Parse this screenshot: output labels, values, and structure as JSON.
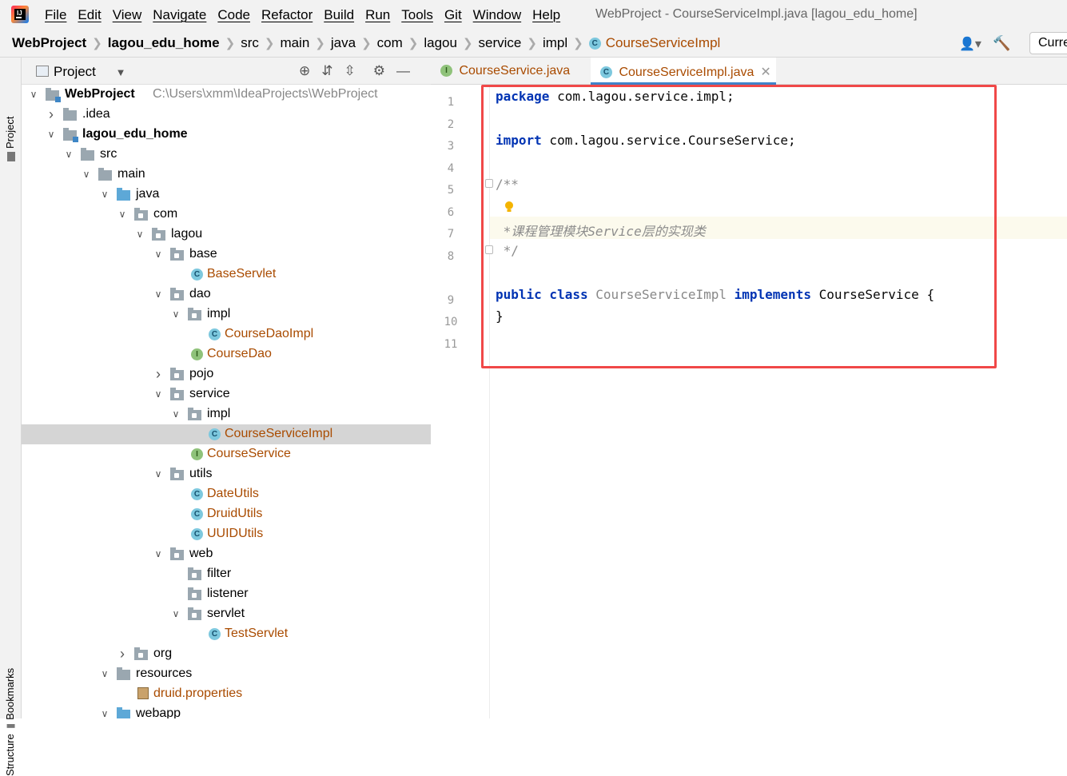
{
  "menubar": {
    "items": [
      "File",
      "Edit",
      "View",
      "Navigate",
      "Code",
      "Refactor",
      "Build",
      "Run",
      "Tools",
      "Git",
      "Window",
      "Help"
    ],
    "title": "WebProject - CourseServiceImpl.java [lagou_edu_home]"
  },
  "breadcrumb": [
    "WebProject",
    "lagou_edu_home",
    "src",
    "main",
    "java",
    "com",
    "lagou",
    "service",
    "impl",
    "CourseServiceImpl"
  ],
  "toolbar": {
    "run_config": "Current File"
  },
  "sidebar": {
    "project_tab": "Project",
    "bookmarks_tab": "Bookmarks",
    "structure_tab": "Structure"
  },
  "project": {
    "title": "Project"
  },
  "tree": [
    {
      "label": "WebProject",
      "extra": "C:\\Users\\xmm\\IdeaProjects\\WebProject",
      "depth": 0,
      "arrow": "open",
      "icon": "module-folder",
      "bold": true
    },
    {
      "label": ".idea",
      "depth": 1,
      "arrow": "closed",
      "icon": "folder"
    },
    {
      "label": "lagou_edu_home",
      "depth": 1,
      "arrow": "open",
      "icon": "module-folder",
      "bold": true
    },
    {
      "label": "src",
      "depth": 2,
      "arrow": "open",
      "icon": "folder"
    },
    {
      "label": "main",
      "depth": 3,
      "arrow": "open",
      "icon": "folder"
    },
    {
      "label": "java",
      "depth": 4,
      "arrow": "open",
      "icon": "source-folder"
    },
    {
      "label": "com",
      "depth": 5,
      "arrow": "open",
      "icon": "package"
    },
    {
      "label": "lagou",
      "depth": 6,
      "arrow": "open",
      "icon": "package"
    },
    {
      "label": "base",
      "depth": 7,
      "arrow": "open",
      "icon": "package"
    },
    {
      "label": "BaseServlet",
      "depth": 8,
      "arrow": "none",
      "icon": "class"
    },
    {
      "label": "dao",
      "depth": 7,
      "arrow": "open",
      "icon": "package"
    },
    {
      "label": "impl",
      "depth": 8,
      "arrow": "open",
      "icon": "package"
    },
    {
      "label": "CourseDaoImpl",
      "depth": 9,
      "arrow": "none",
      "icon": "class"
    },
    {
      "label": "CourseDao",
      "depth": 8,
      "arrow": "none",
      "icon": "interface"
    },
    {
      "label": "pojo",
      "depth": 7,
      "arrow": "closed",
      "icon": "package"
    },
    {
      "label": "service",
      "depth": 7,
      "arrow": "open",
      "icon": "package"
    },
    {
      "label": "impl",
      "depth": 8,
      "arrow": "open",
      "icon": "package"
    },
    {
      "label": "CourseServiceImpl",
      "depth": 9,
      "arrow": "none",
      "icon": "class",
      "selected": true
    },
    {
      "label": "CourseService",
      "depth": 8,
      "arrow": "none",
      "icon": "interface"
    },
    {
      "label": "utils",
      "depth": 7,
      "arrow": "open",
      "icon": "package"
    },
    {
      "label": "DateUtils",
      "depth": 8,
      "arrow": "none",
      "icon": "class"
    },
    {
      "label": "DruidUtils",
      "depth": 8,
      "arrow": "none",
      "icon": "class"
    },
    {
      "label": "UUIDUtils",
      "depth": 8,
      "arrow": "none",
      "icon": "class"
    },
    {
      "label": "web",
      "depth": 7,
      "arrow": "open",
      "icon": "package"
    },
    {
      "label": "filter",
      "depth": 8,
      "arrow": "none",
      "icon": "package"
    },
    {
      "label": "listener",
      "depth": 8,
      "arrow": "none",
      "icon": "package"
    },
    {
      "label": "servlet",
      "depth": 8,
      "arrow": "open",
      "icon": "package"
    },
    {
      "label": "TestServlet",
      "depth": 9,
      "arrow": "none",
      "icon": "class"
    },
    {
      "label": "org",
      "depth": 5,
      "arrow": "closed",
      "icon": "package"
    },
    {
      "label": "resources",
      "depth": 4,
      "arrow": "open",
      "icon": "resources"
    },
    {
      "label": "druid.properties",
      "depth": 5,
      "arrow": "none",
      "icon": "properties"
    },
    {
      "label": "webapp",
      "depth": 4,
      "arrow": "open",
      "icon": "web-folder"
    }
  ],
  "tabs": [
    {
      "label": "CourseService.java",
      "icon": "I",
      "active": false
    },
    {
      "label": "CourseServiceImpl.java",
      "icon": "C",
      "active": true
    }
  ],
  "code": {
    "line_numbers": [
      "1",
      "2",
      "3",
      "4",
      "5",
      "6",
      "7",
      "8",
      "9",
      "10",
      "11"
    ],
    "line1_kw": "package",
    "line1_rest": " com.lagou.service.impl;",
    "line3_kw": "import",
    "line3_rest": " com.lagou.service.CourseService;",
    "line5": "/**",
    "line7": " *课程管理模块Service层的实现类",
    "line8": " */",
    "line9_kw1": "public class",
    "line9_name": " CourseServiceImpl ",
    "line9_kw2": "implements",
    "line9_rest": " CourseService {",
    "line10": "}"
  },
  "colors": {
    "keyword": "#0033b3",
    "comment": "#8c8c8c",
    "class_name": "#a94b00",
    "highlight_box": "#f04848",
    "tab_underline": "#4083c9"
  }
}
